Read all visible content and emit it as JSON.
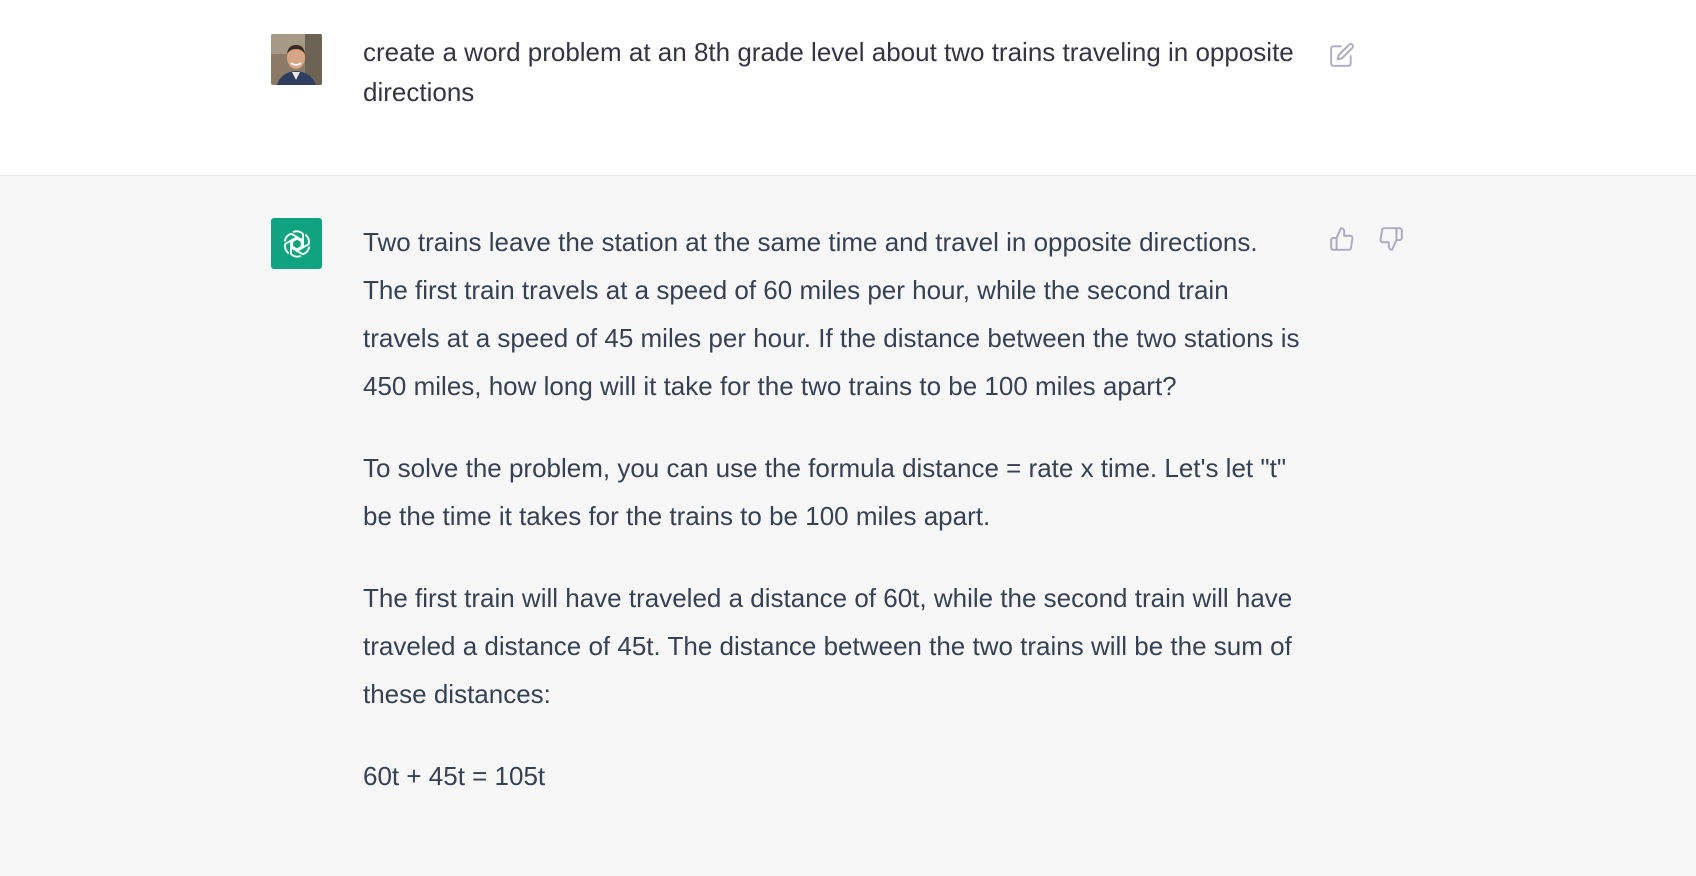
{
  "user_message": {
    "text": "create a word problem at an 8th grade level about two trains traveling in opposite directions",
    "edit_icon": "edit-icon",
    "avatar": "user-avatar"
  },
  "assistant_message": {
    "avatar": "openai-logo-icon",
    "paragraphs": [
      "Two trains leave the station at the same time and travel in opposite directions. The first train travels at a speed of 60 miles per hour, while the second train travels at a speed of 45 miles per hour. If the distance between the two stations is 450 miles, how long will it take for the two trains to be 100 miles apart?",
      "To solve the problem, you can use the formula distance = rate x time. Let's let \"t\" be the time it takes for the trains to be 100 miles apart.",
      "The first train will have traveled a distance of 60t, while the second train will have traveled a distance of 45t. The distance between the two trains will be the sum of these distances:",
      "60t + 45t = 105t"
    ],
    "thumbs_up_icon": "thumbs-up-icon",
    "thumbs_down_icon": "thumbs-down-icon"
  },
  "colors": {
    "user_bg": "#ffffff",
    "assistant_bg": "#f7f7f8",
    "bot_avatar": "#10a37f",
    "text": "#374151",
    "icon": "#acacbe"
  }
}
